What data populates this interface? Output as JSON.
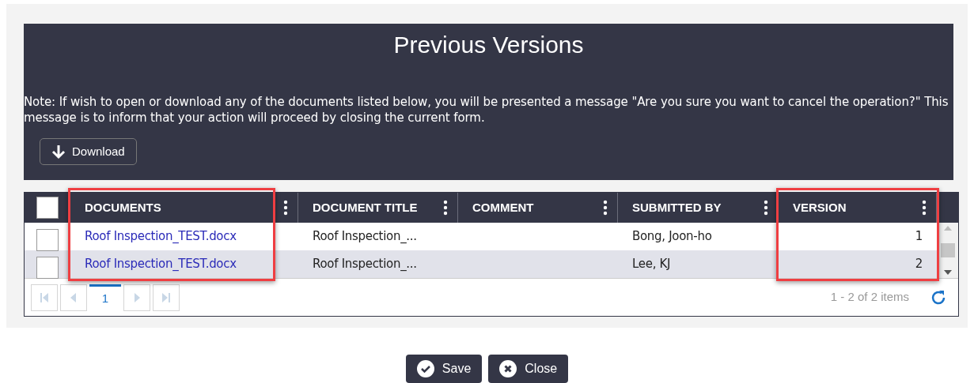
{
  "dialog": {
    "title": "Previous Versions",
    "note": "Note: If wish to open or download any of the documents listed below, you will be presented a message \"Are you sure you want to cancel the operation?\" This message is to inform that your action will proceed by closing the current form.",
    "download_button": "Download"
  },
  "grid": {
    "select_all": {
      "checked": false
    },
    "columns": [
      {
        "label": "DOCUMENTS",
        "highlighted": true
      },
      {
        "label": "DOCUMENT TITLE",
        "highlighted": false
      },
      {
        "label": "COMMENT",
        "highlighted": false
      },
      {
        "label": "SUBMITTED BY",
        "highlighted": false
      },
      {
        "label": "VERSION",
        "highlighted": true
      }
    ],
    "rows": [
      {
        "checked": false,
        "document": "Roof Inspection_TEST.docx",
        "title": "Roof Inspection_...",
        "submitted_by": "Bong, Joon-ho",
        "version": "1"
      },
      {
        "checked": false,
        "document": "Roof Inspection_TEST.docx",
        "title": "Roof Inspection_...",
        "submitted_by": "Lee, KJ",
        "version": "2"
      }
    ],
    "pager": {
      "pages": [
        {
          "label": "1",
          "selected": true
        }
      ],
      "summary": "1 - 2 of 2 items"
    }
  },
  "buttons": [
    {
      "kind": "save",
      "label": "Save"
    },
    {
      "kind": "close",
      "label": "Close"
    }
  ]
}
